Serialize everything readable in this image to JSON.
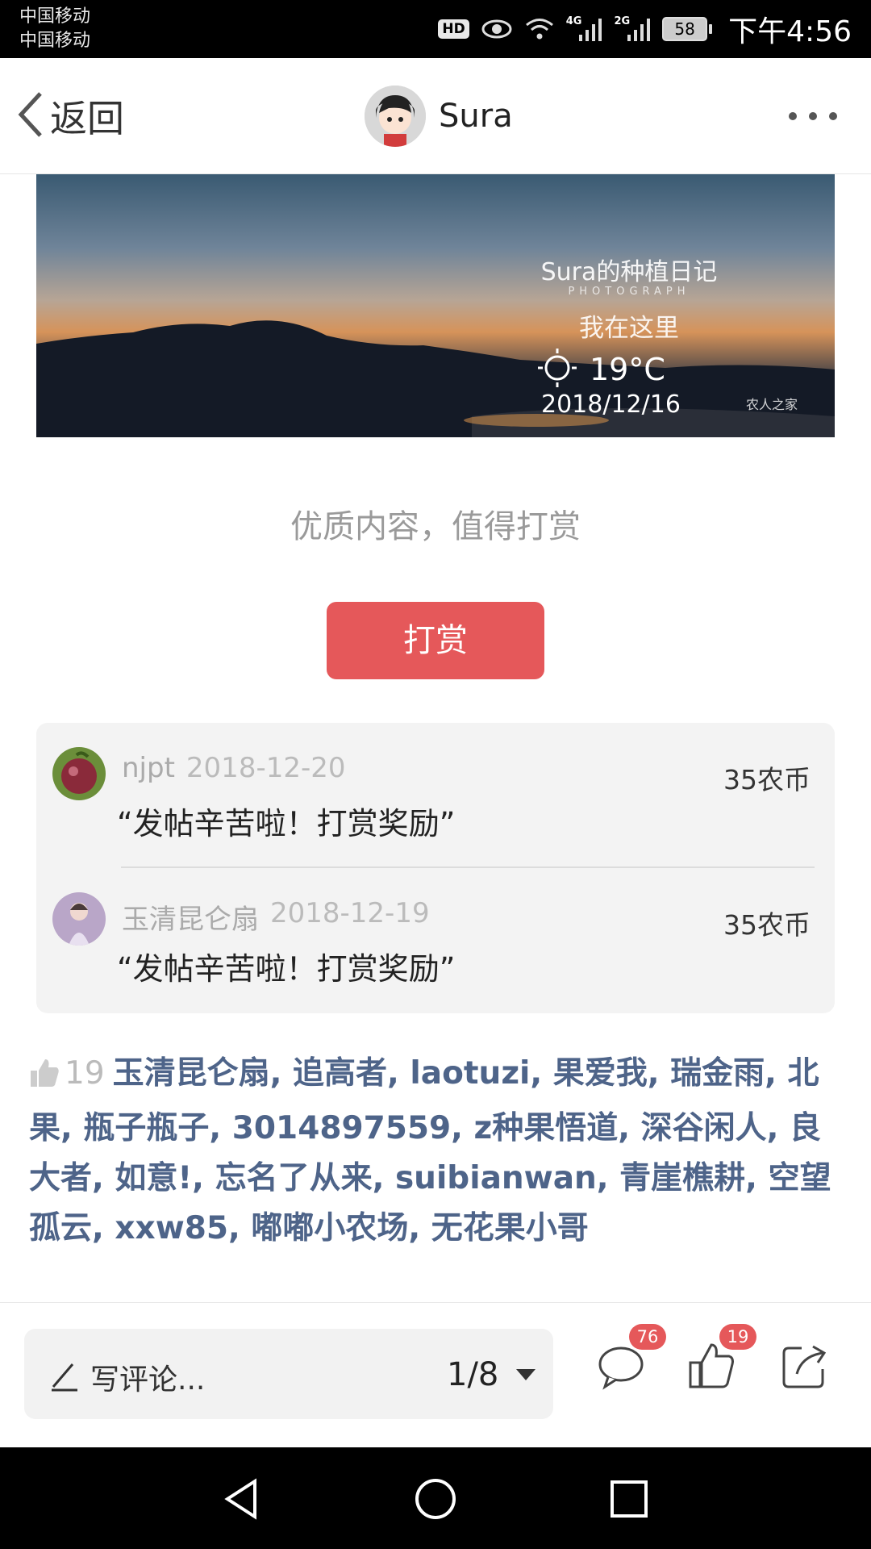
{
  "status_bar": {
    "carrier_1": "中国移动",
    "carrier_2": "中国移动",
    "hd": "HD",
    "net_1": "4G",
    "net_2": "2G",
    "battery": "58",
    "time": "下午4:56"
  },
  "nav": {
    "back_label": "返回",
    "title": "Sura",
    "icons": [
      "chevron-left-icon",
      "avatar",
      "more-icon"
    ]
  },
  "banner": {
    "title": "Sura的种植日记",
    "subtitle": "PHOTOGRAPH",
    "location": "我在这里",
    "temperature": "19°C",
    "date": "2018/12/16",
    "logo": "农人之家"
  },
  "reward": {
    "prompt": "优质内容，值得打赏",
    "button_label": "打赏",
    "button_color": "#e5585a",
    "items": [
      {
        "name": "njpt",
        "date": "2018-12-20",
        "amount": "35农币",
        "message": "“发帖辛苦啦！打赏奖励”"
      },
      {
        "name": "玉清昆仑扇",
        "date": "2018-12-19",
        "amount": "35农币",
        "message": "“发帖辛苦啦！打赏奖励”"
      }
    ]
  },
  "likes": {
    "count": "19",
    "names": "玉清昆仑扇, 追高者, laotuzi, 果爱我, 瑞金雨, 北果, 瓶子瓶子, 3014897559, z种果悟道, 深谷闲人, 良大者, 如意!, 忘名了从来, suibianwan, 青崖樵耕, 空望孤云, xxw85, 嘟嘟小农场, 无花果小哥",
    "name_color": "#4e6489"
  },
  "bottom_bar": {
    "comment_placeholder": "写评论...",
    "page_indicator": "1/8",
    "comment_badge": "76",
    "like_badge": "19",
    "badge_color": "#e5585a"
  }
}
